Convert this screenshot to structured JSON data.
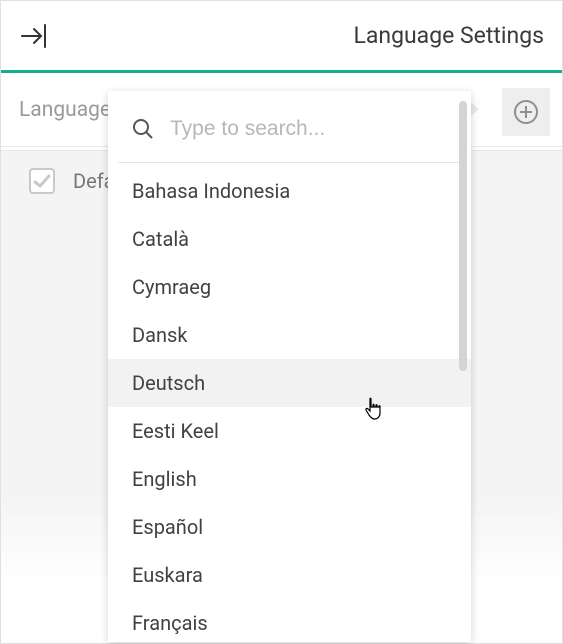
{
  "header": {
    "title": "Language Settings"
  },
  "toolbar": {
    "dropdown_label": "Language"
  },
  "search": {
    "placeholder": "Type to search..."
  },
  "existing_row": {
    "label": "Default"
  },
  "languages": [
    "Bahasa Indonesia",
    "Català",
    "Cymraeg",
    "Dansk",
    "Deutsch",
    "Eesti Keel",
    "English",
    "Español",
    "Euskara",
    "Français"
  ],
  "hovered_index": 4
}
